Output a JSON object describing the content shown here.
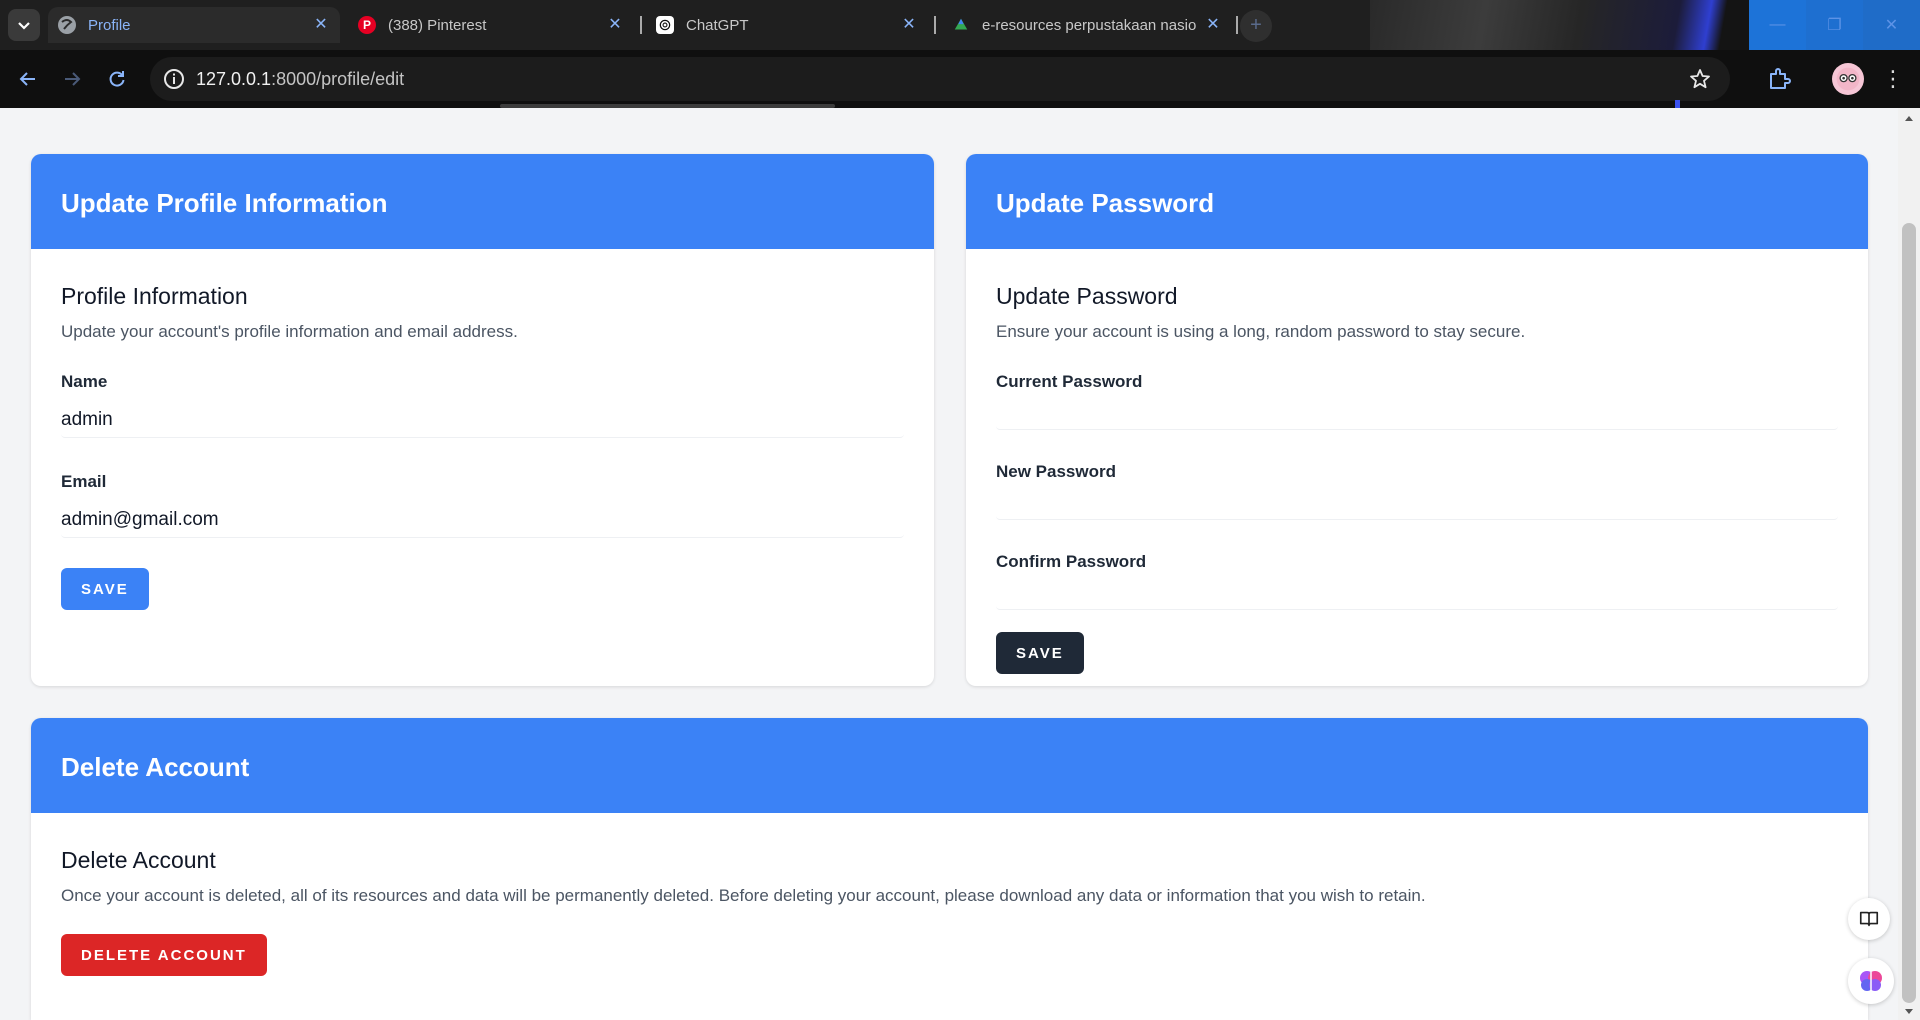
{
  "browser": {
    "tabs": [
      {
        "title": "Profile",
        "active": true
      },
      {
        "title": "(388) Pinterest",
        "active": false
      },
      {
        "title": "ChatGPT",
        "active": false
      },
      {
        "title": "e-resources perpustakaan nasio",
        "active": false
      }
    ],
    "url_host": "127.0.0.1",
    "url_rest": ":8000/profile/edit"
  },
  "profile_card": {
    "header": "Update Profile Information",
    "section_title": "Profile Information",
    "section_desc": "Update your account's profile information and email address.",
    "name_label": "Name",
    "name_value": "admin",
    "email_label": "Email",
    "email_value": "admin@gmail.com",
    "save_label": "SAVE"
  },
  "password_card": {
    "header": "Update Password",
    "section_title": "Update Password",
    "section_desc": "Ensure your account is using a long, random password to stay secure.",
    "current_label": "Current Password",
    "new_label": "New Password",
    "confirm_label": "Confirm Password",
    "save_label": "SAVE"
  },
  "delete_card": {
    "header": "Delete Account",
    "section_title": "Delete Account",
    "section_desc": "Once your account is deleted, all of its resources and data will be permanently deleted. Before deleting your account, please download any data or information that you wish to retain.",
    "delete_label": "DELETE ACCOUNT"
  },
  "colors": {
    "accent": "#3b82f6",
    "danger": "#dc2626",
    "dark_button": "#1f2937",
    "page_bg": "#f3f4f6"
  },
  "icons": [
    "chevron-down-icon",
    "globe-icon",
    "pinterest-icon",
    "chatgpt-icon",
    "drive-icon",
    "close-icon",
    "plus-icon",
    "back-arrow-icon",
    "forward-arrow-icon",
    "reload-icon",
    "info-icon",
    "star-icon",
    "extension-icon",
    "avatar-icon",
    "kebab-menu-icon",
    "reader-icon",
    "brain-icon"
  ]
}
